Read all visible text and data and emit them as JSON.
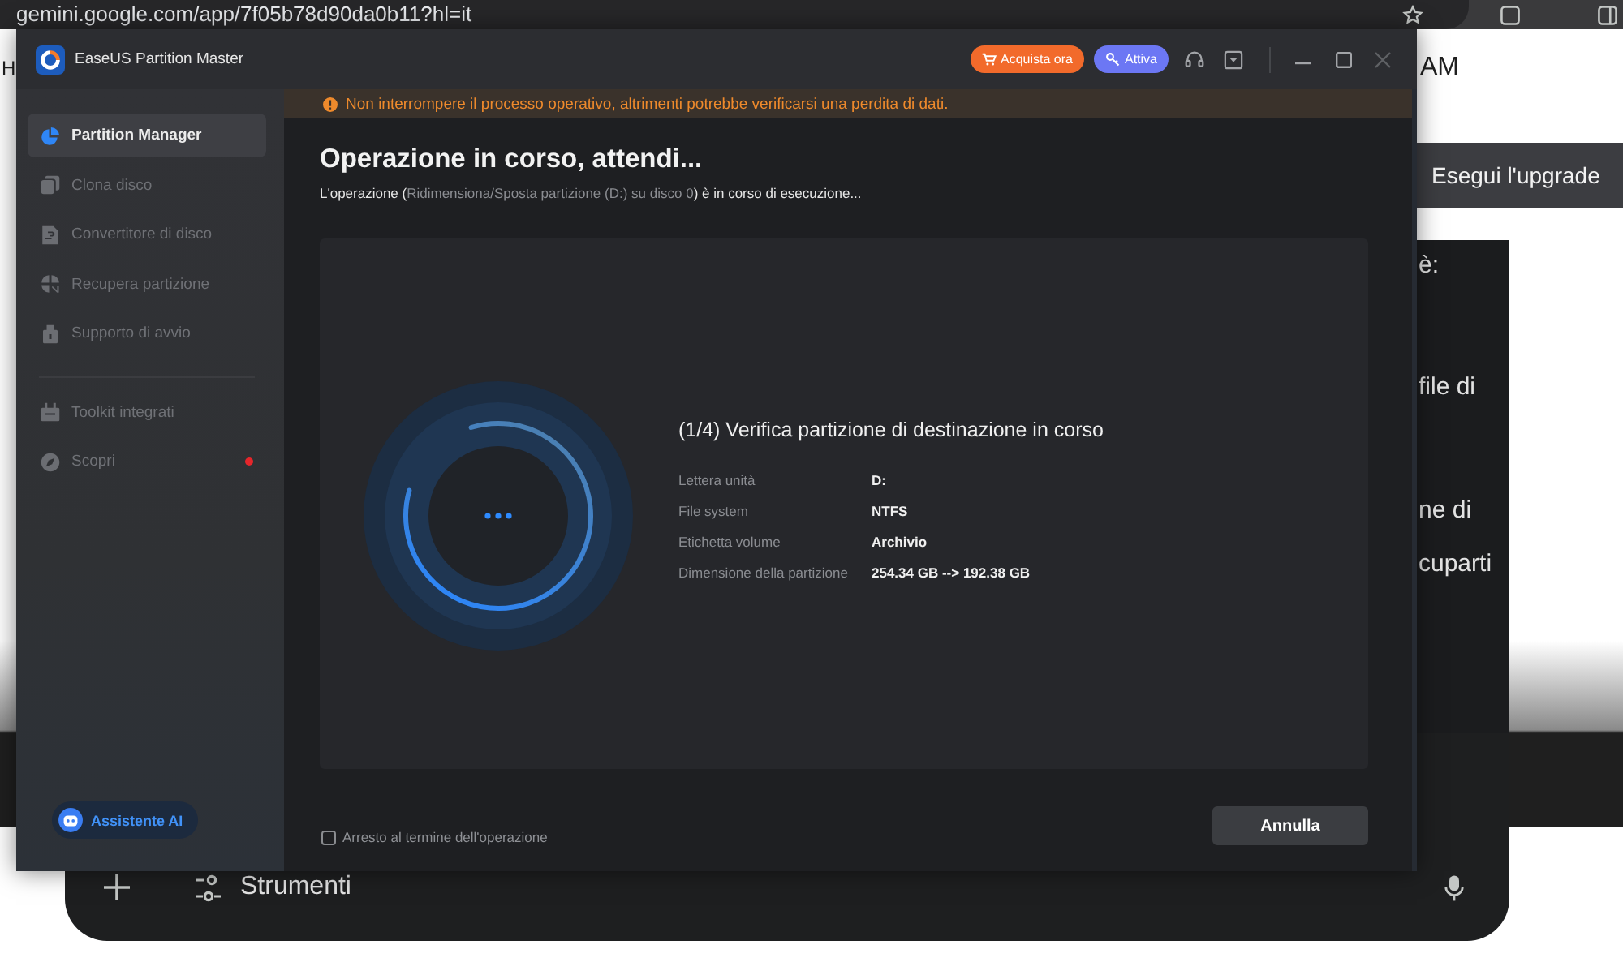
{
  "browser": {
    "address": "gemini.google.com/app/7f05b78d90da0b11?hl=it"
  },
  "page": {
    "header_left": "H",
    "header_right": "AM",
    "upgrade_button": "Esegui l'upgrade",
    "response_lines": [
      "è:",
      "file di",
      "ne di",
      "cuparti"
    ],
    "prompt_bar": {
      "tools_button": "Strumenti"
    }
  },
  "app_window": {
    "title": "EaseUS Partition Master",
    "buy_button": "Acquista ora",
    "activate_button": "Attiva",
    "sidebar": {
      "sections": [
        {
          "items": [
            {
              "label": "Partition Manager",
              "selected": true,
              "notification": false
            },
            {
              "label": "Clona disco",
              "selected": false,
              "notification": false
            },
            {
              "label": "Convertitore di disco",
              "selected": false,
              "notification": false
            },
            {
              "label": "Recupera partizione",
              "selected": false,
              "notification": false
            },
            {
              "label": "Supporto di avvio",
              "selected": false,
              "notification": false
            }
          ]
        },
        {
          "items": [
            {
              "label": "Toolkit integrati",
              "selected": false,
              "notification": false
            },
            {
              "label": "Scopri",
              "selected": false,
              "notification": true
            }
          ]
        }
      ],
      "assistant_button": "Assistente AI"
    },
    "warning": "Non interrompere il processo operativo, altrimenti potrebbe verificarsi una perdita di dati.",
    "heading": "Operazione in corso, attendi...",
    "subtitle": {
      "before": "L'operazione (",
      "operation": "Ridimensiona/Sposta partizione (D:) su disco 0",
      "after": ") è in corso di esecuzione..."
    },
    "progress": {
      "step": "(1/4) Verifica partizione di destinazione in corso",
      "details": [
        {
          "label": "Lettera unità",
          "value": "D:"
        },
        {
          "label": "File system",
          "value": "NTFS"
        },
        {
          "label": "Etichetta volume",
          "value": "Archivio"
        },
        {
          "label": "Dimensione della partizione",
          "value": "254.34 GB --> 192.38 GB"
        }
      ]
    },
    "shutdown_option": {
      "label": "Arresto al termine dell'operazione",
      "checked": false
    },
    "cancel_button": "Annulla"
  }
}
